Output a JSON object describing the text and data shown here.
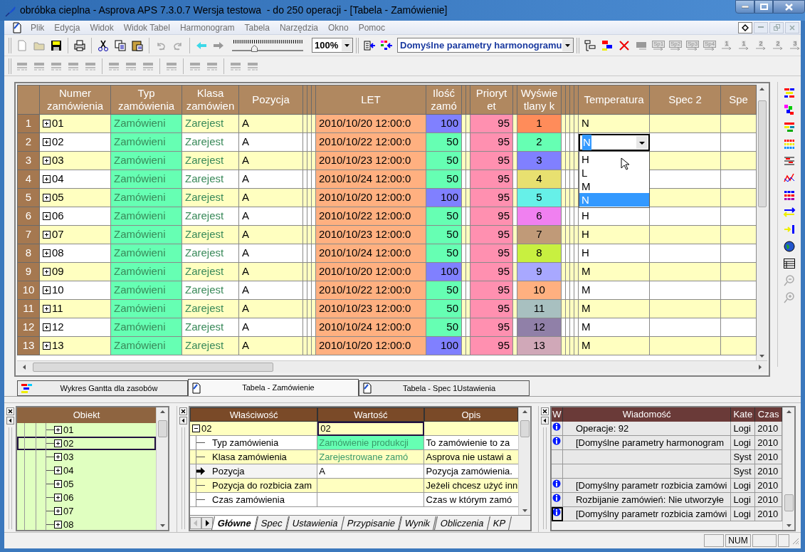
{
  "window": {
    "title": "obróbka cieplna - Asprova APS 7.3.0.7 Wersja testowa  - do 250 operacji - [Tabela - Zamówienie]"
  },
  "menu": [
    "Plik",
    "Edycja",
    "Widok",
    "Widok Tabel",
    "Harmonogram",
    "Tabela",
    "Narzędzia",
    "Okno",
    "Pomoc"
  ],
  "toolbar": {
    "zoom_slider": {
      "level": 0.3
    },
    "zoom": "100%",
    "schedule_parameters": "Domyślne parametry harmonogramu",
    "buttons": [
      {
        "label": "Sp1",
        "disabled": true
      },
      {
        "label": "Sp2",
        "disabled": true
      },
      {
        "label": "Sp3",
        "disabled": true
      },
      {
        "label": "Sp4",
        "disabled": true
      },
      {
        "label": "1",
        "disabled": true
      },
      {
        "label": "1",
        "disabled": true
      },
      {
        "label": "2",
        "disabled": true
      },
      {
        "label": "2",
        "disabled": true
      },
      {
        "label": "3",
        "disabled": true
      }
    ]
  },
  "table": {
    "columns": [
      {
        "label": "Numer\nzamówienia"
      },
      {
        "label": "Typ\nzamówienia"
      },
      {
        "label": "Klasa\nzamówien"
      },
      {
        "label": "Pozycja"
      },
      {
        "label": "LET"
      },
      {
        "label": "Ilość\nzamó"
      },
      {
        "label": "Prioryt\net"
      },
      {
        "label": "Wyświe\ntlany k"
      },
      {
        "label": "Temperatura"
      },
      {
        "label": "Spec 2"
      },
      {
        "label": "Spe"
      }
    ],
    "rows": [
      {
        "number": "1",
        "order": "01",
        "expanded": false,
        "type": "Zamówieni",
        "class": "Zarejest",
        "position": "A",
        "let": "2010/10/20 12:00:0",
        "quantity": {
          "text": "100",
          "color": "#8080ff"
        },
        "priority": "95",
        "display": {
          "text": "1",
          "color": "#ff8c5a"
        },
        "temperature": "N",
        "editing": false
      },
      {
        "number": "2",
        "order": "02",
        "expanded": false,
        "type": "Zamówieni",
        "class": "Zarejest",
        "position": "A",
        "let": "2010/10/22 12:00:0",
        "quantity": {
          "text": "50",
          "color": "#66ffb3"
        },
        "priority": "95",
        "display": {
          "text": "2",
          "color": "#66ffb3"
        },
        "editing": true
      },
      {
        "number": "3",
        "order": "03",
        "expanded": false,
        "type": "Zamówieni",
        "class": "Zarejest",
        "position": "A",
        "let": "2010/10/23 12:00:0",
        "quantity": {
          "text": "50",
          "color": "#66ffb3"
        },
        "priority": "95",
        "display": {
          "text": "3",
          "color": "#8080ff"
        },
        "editing": false
      },
      {
        "number": "4",
        "order": "04",
        "expanded": false,
        "type": "Zamówieni",
        "class": "Zarejest",
        "position": "A",
        "let": "2010/10/24 12:00:0",
        "quantity": {
          "text": "50",
          "color": "#66ffb3"
        },
        "priority": "95",
        "display": {
          "text": "4",
          "color": "#e8e070"
        },
        "editing": false
      },
      {
        "number": "5",
        "order": "05",
        "expanded": false,
        "type": "Zamówieni",
        "class": "Zarejest",
        "position": "A",
        "let": "2010/10/20 12:00:0",
        "quantity": {
          "text": "100",
          "color": "#8080ff"
        },
        "priority": "95",
        "display": {
          "text": "5",
          "color": "#66f0e8"
        },
        "editing": false
      },
      {
        "number": "6",
        "order": "06",
        "expanded": false,
        "type": "Zamówieni",
        "class": "Zarejest",
        "position": "A",
        "let": "2010/10/22 12:00:0",
        "quantity": {
          "text": "50",
          "color": "#66ffb3"
        },
        "priority": "95",
        "display": {
          "text": "6",
          "color": "#f080f0"
        },
        "temperature": "H",
        "editing": false
      },
      {
        "number": "7",
        "order": "07",
        "expanded": false,
        "type": "Zamówieni",
        "class": "Zarejest",
        "position": "A",
        "let": "2010/10/23 12:00:0",
        "quantity": {
          "text": "50",
          "color": "#66ffb3"
        },
        "priority": "95",
        "display": {
          "text": "7",
          "color": "#c09a78"
        },
        "temperature": "H",
        "editing": false
      },
      {
        "number": "8",
        "order": "08",
        "expanded": false,
        "type": "Zamówieni",
        "class": "Zarejest",
        "position": "A",
        "let": "2010/10/24 12:00:0",
        "quantity": {
          "text": "50",
          "color": "#66ffb3"
        },
        "priority": "95",
        "display": {
          "text": "8",
          "color": "#c8f040"
        },
        "temperature": "H",
        "editing": false
      },
      {
        "number": "9",
        "order": "09",
        "expanded": false,
        "type": "Zamówieni",
        "class": "Zarejest",
        "position": "A",
        "let": "2010/10/20 12:00:0",
        "quantity": {
          "text": "100",
          "color": "#8080ff"
        },
        "priority": "95",
        "display": {
          "text": "9",
          "color": "#a8a8ff"
        },
        "temperature": "M",
        "editing": false
      },
      {
        "number": "10",
        "order": "10",
        "expanded": false,
        "type": "Zamówieni",
        "class": "Zarejest",
        "position": "A",
        "let": "2010/10/22 12:00:0",
        "quantity": {
          "text": "50",
          "color": "#66ffb3"
        },
        "priority": "95",
        "display": {
          "text": "10",
          "color": "#ffb080"
        },
        "temperature": "M",
        "editing": false
      },
      {
        "number": "11",
        "order": "11",
        "expanded": false,
        "type": "Zamówieni",
        "class": "Zarejest",
        "position": "A",
        "let": "2010/10/23 12:00:0",
        "quantity": {
          "text": "50",
          "color": "#66ffb3"
        },
        "priority": "95",
        "display": {
          "text": "11",
          "color": "#a8c0c0"
        },
        "temperature": "M",
        "editing": false
      },
      {
        "number": "12",
        "order": "12",
        "expanded": false,
        "type": "Zamówieni",
        "class": "Zarejest",
        "position": "A",
        "let": "2010/10/24 12:00:0",
        "quantity": {
          "text": "50",
          "color": "#66ffb3"
        },
        "priority": "95",
        "display": {
          "text": "12",
          "color": "#9080a8"
        },
        "temperature": "M",
        "editing": false
      },
      {
        "number": "13",
        "order": "13",
        "expanded": false,
        "type": "Zamówieni",
        "class": "Zarejest",
        "position": "A",
        "let": "2010/10/20 12:00:0",
        "quantity": {
          "text": "100",
          "color": "#8080ff"
        },
        "priority": "95",
        "display": {
          "text": "13",
          "color": "#d0a8b8"
        },
        "temperature": "M",
        "editing": false
      }
    ],
    "editor": {
      "value": "N",
      "options": [
        {
          "label": "H",
          "selected": false
        },
        {
          "label": "L",
          "selected": false
        },
        {
          "label": "M",
          "selected": false
        },
        {
          "label": "N",
          "selected": true
        }
      ]
    }
  },
  "document_tabs": [
    {
      "label": "Wykres Gantta dla zasobów",
      "kind": "gantt",
      "selected": false
    },
    {
      "label": "Tabela - Zamówienie",
      "kind": "table",
      "selected": true
    },
    {
      "label": "Tabela - Spec 1Ustawienia",
      "kind": "table",
      "selected": false
    }
  ],
  "object_tree": {
    "header": "Obiekt",
    "items": [
      {
        "label": "01",
        "expanded": false,
        "selected": false
      },
      {
        "label": "02",
        "expanded": false,
        "selected": true
      },
      {
        "label": "03",
        "expanded": false,
        "selected": false
      },
      {
        "label": "04",
        "expanded": false,
        "selected": false
      },
      {
        "label": "05",
        "expanded": false,
        "selected": false
      },
      {
        "label": "06",
        "expanded": false,
        "selected": false
      },
      {
        "label": "07",
        "expanded": false,
        "selected": false
      },
      {
        "label": "08",
        "expanded": false,
        "selected": false
      }
    ]
  },
  "properties": {
    "columns": [
      "Właściwość",
      "Wartość",
      "Opis"
    ],
    "rows": [
      {
        "kind": "group",
        "property": "02",
        "expanded": true,
        "value": "02",
        "description": ""
      },
      {
        "kind": "item",
        "property": "Typ zamówienia",
        "value": "Zamówienie produkcji",
        "color": "#66ffb3",
        "linked": true,
        "description": "To zamówienie to za",
        "current": false
      },
      {
        "kind": "item",
        "property": "Klasa zamówienia",
        "value": "Zarejestrowane zamó",
        "linked": true,
        "description": "Asprova nie ustawi a",
        "current": false
      },
      {
        "kind": "item",
        "property": "Pozycja",
        "value": "A",
        "linked": false,
        "description": "Pozycja zamówienia.",
        "current": true
      },
      {
        "kind": "item",
        "property": "Pozycja do rozbicia zam",
        "value": "",
        "description": "Jeżeli chcesz użyć inn",
        "current": false
      },
      {
        "kind": "item",
        "property": "Czas zamówienia",
        "value": "",
        "description": "Czas w którym zamó",
        "current": false
      }
    ],
    "tabs": [
      {
        "label": "Główne",
        "selected": true
      },
      {
        "label": "Spec",
        "selected": false
      },
      {
        "label": "Ustawienia",
        "selected": false
      },
      {
        "label": "Przypisanie",
        "selected": false
      },
      {
        "label": "Wynik",
        "selected": false
      },
      {
        "label": "Obliczenia",
        "selected": false
      },
      {
        "label": "KP",
        "selected": false
      }
    ]
  },
  "messages": {
    "columns": [
      "W",
      "Wiadomość",
      "Kate",
      "Czas"
    ],
    "rows": [
      {
        "kind": "info",
        "message": "Operacje: 92",
        "category": "Logi",
        "time": "2010",
        "selected": false
      },
      {
        "kind": "info",
        "message": "[Domyślne parametry harmonogram",
        "category": "Logi",
        "time": "2010",
        "selected": false
      },
      {
        "kind": "plain",
        "category": "Syst",
        "time": "2010",
        "selected": false
      },
      {
        "kind": "plain",
        "category": "Syst",
        "time": "2010",
        "selected": false
      },
      {
        "kind": "info",
        "message": "[Domyślny parametr rozbicia zamówi",
        "category": "Logi",
        "time": "2010",
        "selected": false
      },
      {
        "kind": "info",
        "message": "Rozbijanie zamówień: Nie utworzyłe",
        "category": "Logi",
        "time": "2010",
        "selected": false
      },
      {
        "kind": "info",
        "message": "[Domyślny parametr rozbicia zamówi",
        "category": "Logi",
        "time": "2010",
        "selected": true
      }
    ]
  },
  "status_bar": {
    "indicator": "NUM"
  }
}
